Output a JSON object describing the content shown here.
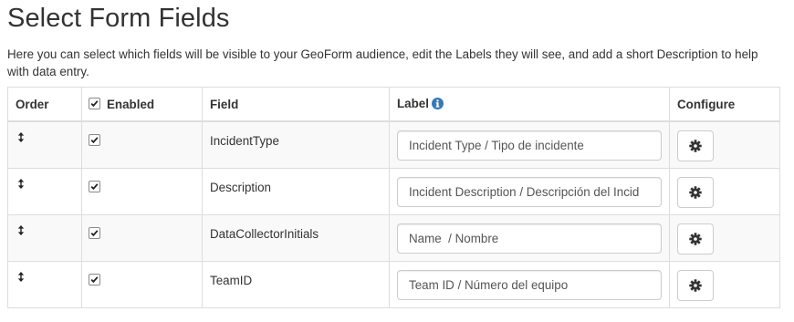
{
  "page": {
    "title": "Select Form Fields",
    "intro": "Here you can select which fields will be visible to your GeoForm audience, edit the Labels they will see, and add a short Description to help with data entry."
  },
  "table": {
    "headers": {
      "order": "Order",
      "enabled": "Enabled",
      "field": "Field",
      "label": "Label",
      "configure": "Configure"
    },
    "header_enabled_checked": true,
    "rows": [
      {
        "field": "IncidentType",
        "enabled": true,
        "label": "Incident Type / Tipo de incidente"
      },
      {
        "field": "Description",
        "enabled": true,
        "label": "Incident Description / Descripción del Incid"
      },
      {
        "field": "DataCollectorInitials",
        "enabled": true,
        "label": "Name  / Nombre"
      },
      {
        "field": "TeamID",
        "enabled": true,
        "label": "Team ID / Número del equipo"
      }
    ]
  },
  "icons": {
    "order": "sort-arrows-icon",
    "label_info": "info-icon",
    "configure": "gear-icon"
  },
  "colors": {
    "info_icon": "#337ab7",
    "stripe": "#f9f9f9",
    "border": "#dddddd"
  }
}
